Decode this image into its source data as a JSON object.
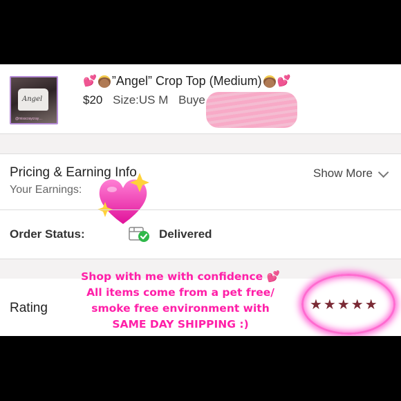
{
  "listing": {
    "title": "”Angel” Crop Top (Medium)",
    "price": "$20",
    "size": "Size:US M",
    "buyer_prefix": "Buye",
    "thumbnail": {
      "script_text": "Angel",
      "watermark": "@misscraycray…"
    },
    "title_emojis": [
      "pink-hearts-emoji",
      "baby-angel-emoji"
    ]
  },
  "pricing": {
    "title": "Pricing & Earning Info",
    "show_more": "Show More",
    "earnings_label": "Your Earnings:",
    "earnings_icon": "sparkling-heart-emoji"
  },
  "order": {
    "label": "Order Status:",
    "status": "Delivered",
    "status_icon": "package-delivered-icon"
  },
  "rating": {
    "label": "Rating",
    "stars": "★★★★★",
    "star_color": "#7a2a35",
    "highlight_color": "#ff63d6"
  },
  "promo": {
    "lines": [
      "Shop with me with confidence 💕",
      "All items come from a pet free/",
      "smoke free environment with",
      "SAME DAY SHIPPING :)"
    ],
    "color": "#ff1fa8"
  }
}
